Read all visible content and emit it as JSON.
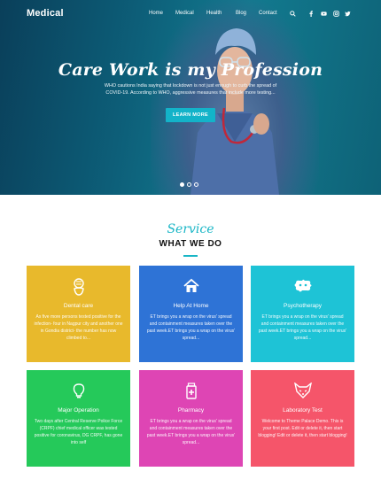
{
  "brand": {
    "logo": "Medical"
  },
  "nav": {
    "items": [
      "Home",
      "Medical",
      "Health",
      "Blog",
      "Contact"
    ],
    "icons": [
      "search-icon",
      "facebook-icon",
      "youtube-icon",
      "instagram-icon",
      "twitter-icon"
    ]
  },
  "hero": {
    "title": "Care Work is my Profession",
    "text": "WHO cautions India saying that lockdown is not just enough to curb the spread of COVID-19. According to WHO, aggressive measures that include more testing...",
    "button": "LEARN MORE",
    "slides": 3,
    "active_slide": 1
  },
  "service": {
    "script": "Service",
    "title": "WHAT WE DO"
  },
  "cards": [
    {
      "title": "Dental care",
      "icon": "tooth-icon",
      "color": "#e8b92c",
      "desc": "As five more persons tested positive for the infection- four in Nagpur city and another one in Gondia district- the number has now climbed to..."
    },
    {
      "title": "Help At Home",
      "icon": "home-icon",
      "color": "#2e73d6",
      "desc": "ET brings you a wrap on the virus' spread and containment measures taken over the past week.ET brings you a wrap on the virus' spread..."
    },
    {
      "title": "Psychotherapy",
      "icon": "puzzle-icon",
      "color": "#1ec3d6",
      "desc": "ET brings you a wrap on the virus' spread and containment measures taken over the past week.ET brings you a wrap on the virus' spread..."
    },
    {
      "title": "Major Operation",
      "icon": "lightbulb-icon",
      "color": "#25c95a",
      "desc": "Two days after Central Reserve Police Force (CRPF) chief medical officer was tested positive for coronavirus, DG CRPF, has gone into self"
    },
    {
      "title": "Pharmacy",
      "icon": "pharmacy-icon",
      "color": "#de45b4",
      "desc": "ET brings you a wrap on the virus' spread and containment measures taken over the past week.ET brings you a wrap on the virus' spread..."
    },
    {
      "title": "Laboratory Test",
      "icon": "fox-icon",
      "color": "#f5556a",
      "desc": "Welcome to Theme Palace Demo. This is your first post. Edit or delete it, then start blogging! Edit or delete it, then start blogging!"
    }
  ]
}
